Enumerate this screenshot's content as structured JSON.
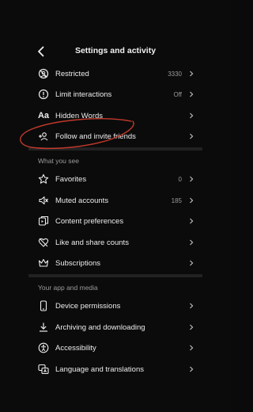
{
  "header": {
    "title": "Settings and activity"
  },
  "group1": {
    "items": [
      {
        "label": "Restricted",
        "value": "3330",
        "icon": "restricted-icon"
      },
      {
        "label": "Limit interactions",
        "value": "Off",
        "icon": "limit-icon"
      },
      {
        "label": "Hidden Words",
        "value": "",
        "icon": "text-aa-icon"
      },
      {
        "label": "Follow and invite friends",
        "value": "",
        "icon": "add-person-icon"
      }
    ]
  },
  "section_what": {
    "label": "What you see",
    "items": [
      {
        "label": "Favorites",
        "value": "0",
        "icon": "star-icon"
      },
      {
        "label": "Muted accounts",
        "value": "185",
        "icon": "muted-icon"
      },
      {
        "label": "Content preferences",
        "value": "",
        "icon": "content-icon"
      },
      {
        "label": "Like and share counts",
        "value": "",
        "icon": "heart-slash-icon"
      },
      {
        "label": "Subscriptions",
        "value": "",
        "icon": "crown-icon"
      }
    ]
  },
  "section_app": {
    "label": "Your app and media",
    "items": [
      {
        "label": "Device permissions",
        "value": "",
        "icon": "phone-icon"
      },
      {
        "label": "Archiving and downloading",
        "value": "",
        "icon": "download-icon"
      },
      {
        "label": "Accessibility",
        "value": "",
        "icon": "accessibility-icon"
      },
      {
        "label": "Language and translations",
        "value": "",
        "icon": "language-icon"
      }
    ]
  },
  "colors": {
    "background": "#0b0b0b",
    "text": "#ececec",
    "muted": "#9a9a9a",
    "annotation": "#c0392b"
  }
}
